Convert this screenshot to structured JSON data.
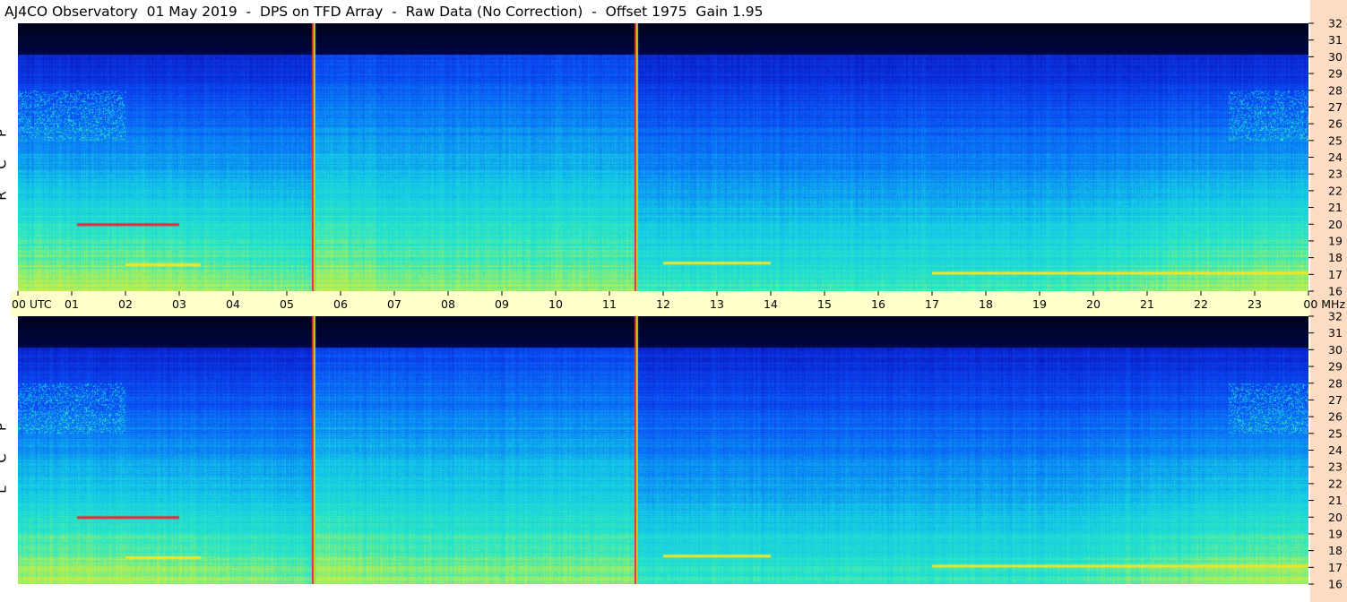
{
  "title": "AJ4CO Observatory  01 May 2019  -  DPS on TFD Array  -  Raw Data (No Correction)  -  Offset 1975  Gain 1.95",
  "panels": [
    {
      "id": "rcp",
      "label": "RCP",
      "letters": [
        "R",
        "C",
        "P"
      ]
    },
    {
      "id": "lcp",
      "label": "LCP",
      "letters": [
        "L",
        "C",
        "P"
      ]
    }
  ],
  "colors": {
    "background": "#ffffff",
    "time_bar": "#ffffcc",
    "freq_strip": "#fddcc4",
    "colormap": [
      "#000010",
      "#000a5a",
      "#0a1ec8",
      "#0a46f0",
      "#0a82f5",
      "#14c8e6",
      "#28e6c8",
      "#aaf05a",
      "#f0e628",
      "#e6283c"
    ]
  },
  "chart_data": {
    "type": "heatmap",
    "title": "AJ4CO Observatory  01 May 2019  -  DPS on TFD Array  -  Raw Data (No Correction)  -  Offset 1975  Gain 1.95",
    "x_axis": {
      "range": [
        0,
        24
      ],
      "units": "UTC",
      "tick_labels": [
        "00",
        "01",
        "02",
        "03",
        "04",
        "05",
        "06",
        "07",
        "08",
        "09",
        "10",
        "11",
        "12",
        "13",
        "14",
        "15",
        "16",
        "17",
        "18",
        "19",
        "20",
        "21",
        "22",
        "23",
        "00"
      ],
      "start_label": "00  UTC",
      "end_label": "00 MHz"
    },
    "y_axis": {
      "range": [
        16,
        32
      ],
      "units": "MHz",
      "tick_labels": [
        "16",
        "17",
        "18",
        "19",
        "20",
        "21",
        "22",
        "23",
        "24",
        "25",
        "26",
        "27",
        "28",
        "29",
        "30",
        "31",
        "32"
      ]
    },
    "series": [
      {
        "name": "RCP"
      },
      {
        "name": "LCP"
      }
    ],
    "features": {
      "vertical_lines_utc": [
        5.5,
        11.5
      ],
      "horizontal_streaks": [
        {
          "freq_mhz": 20.0,
          "utc_start": 1.1,
          "utc_end": 3.0
        },
        {
          "freq_mhz": 17.6,
          "utc_start": 2.0,
          "utc_end": 3.4
        },
        {
          "freq_mhz": 17.7,
          "utc_start": 12.0,
          "utc_end": 14.0
        },
        {
          "freq_mhz": 17.1,
          "utc_start": 17.0,
          "utc_end": 24.0
        }
      ]
    }
  }
}
